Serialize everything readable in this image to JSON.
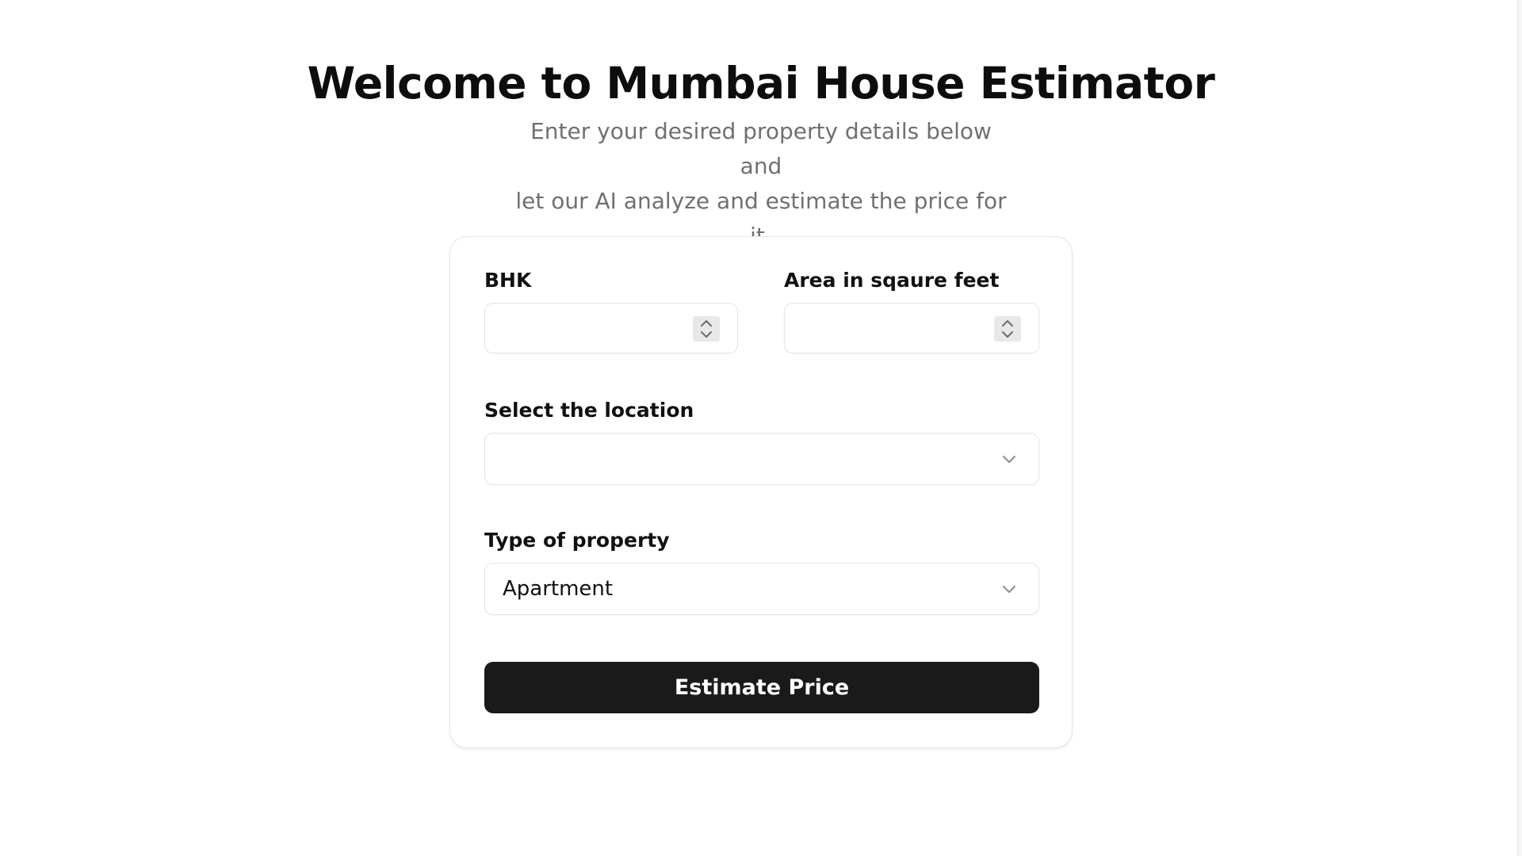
{
  "header": {
    "title": "Welcome to Mumbai House Estimator",
    "subtitle_line1": "Enter your desired property details below and",
    "subtitle_line2": "let our AI analyze and estimate the price for it."
  },
  "form": {
    "bhk": {
      "label": "BHK",
      "value": ""
    },
    "area": {
      "label": "Area in sqaure feet",
      "value": ""
    },
    "location": {
      "label": "Select the location",
      "selected": ""
    },
    "property_type": {
      "label": "Type of property",
      "selected": "Apartment"
    },
    "submit_label": "Estimate Price"
  },
  "icons": {
    "spinner": "up-down-stepper-icon",
    "dropdown": "chevron-down-icon"
  },
  "colors": {
    "button_bg": "#1a1a1a",
    "subtitle": "#707070",
    "border": "#e4e4e7"
  }
}
